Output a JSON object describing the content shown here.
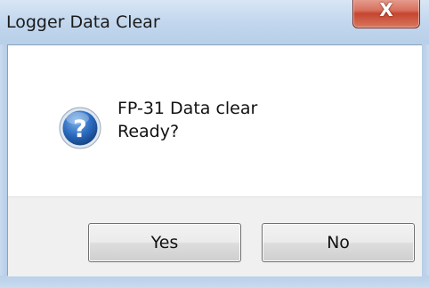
{
  "window": {
    "title": "Logger Data Clear",
    "close_glyph": "X"
  },
  "message": {
    "icon": "question-icon",
    "line1": "FP-31 Data clear",
    "line2": "Ready?"
  },
  "buttons": {
    "yes_label": "Yes",
    "no_label": "No"
  },
  "colors": {
    "titlebar": "#c4d8ee",
    "close_button": "#c54530",
    "button_area": "#f0f0f0",
    "icon_blue": "#1c5aa8"
  }
}
